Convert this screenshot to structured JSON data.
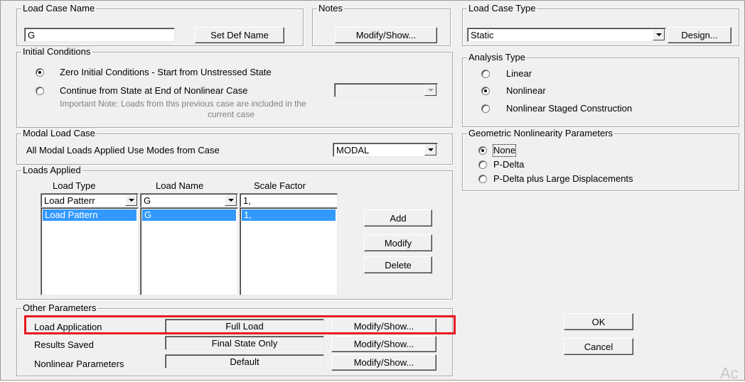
{
  "load_case_name": {
    "title": "Load Case Name",
    "value": "G",
    "set_def_name_label": "Set Def Name"
  },
  "notes": {
    "title": "Notes",
    "modify_show_label": "Modify/Show..."
  },
  "load_case_type": {
    "title": "Load Case Type",
    "value": "Static",
    "design_label": "Design..."
  },
  "initial_conditions": {
    "title": "Initial Conditions",
    "option_zero": "Zero Initial Conditions - Start from Unstressed State",
    "option_continue": "Continue from State at End of Nonlinear Case",
    "note_line1": "Important Note:  Loads from this previous case are included in the",
    "note_line2": "current case"
  },
  "analysis_type": {
    "title": "Analysis Type",
    "options": [
      "Linear",
      "Nonlinear",
      "Nonlinear Staged Construction"
    ],
    "selected": "Nonlinear"
  },
  "modal_load_case": {
    "title": "Modal Load Case",
    "label": "All Modal Loads Applied Use Modes from Case",
    "value": "MODAL"
  },
  "geometric_nonlinearity": {
    "title": "Geometric Nonlinearity Parameters",
    "options": [
      "None",
      "P-Delta",
      "P-Delta plus Large Displacements"
    ],
    "selected": "None"
  },
  "loads_applied": {
    "title": "Loads Applied",
    "headers": [
      "Load Type",
      "Load Name",
      "Scale Factor"
    ],
    "edit_row": [
      "Load Patterr",
      "G",
      "1,"
    ],
    "rows": [
      [
        "Load Pattern",
        "G",
        "1,"
      ]
    ],
    "add_label": "Add",
    "modify_label": "Modify",
    "delete_label": "Delete"
  },
  "other_parameters": {
    "title": "Other Parameters",
    "rows": [
      {
        "label": "Load Application",
        "value": "Full Load",
        "button": "Modify/Show..."
      },
      {
        "label": "Results Saved",
        "value": "Final State Only",
        "button": "Modify/Show..."
      },
      {
        "label": "Nonlinear Parameters",
        "value": "Default",
        "button": "Modify/Show..."
      }
    ]
  },
  "ok_label": "OK",
  "cancel_label": "Cancel",
  "watermark": "Ac",
  "colors": {
    "highlight": "#e8171f",
    "selection": "#3399ff",
    "dialog_bg": "#f0f0f0"
  }
}
